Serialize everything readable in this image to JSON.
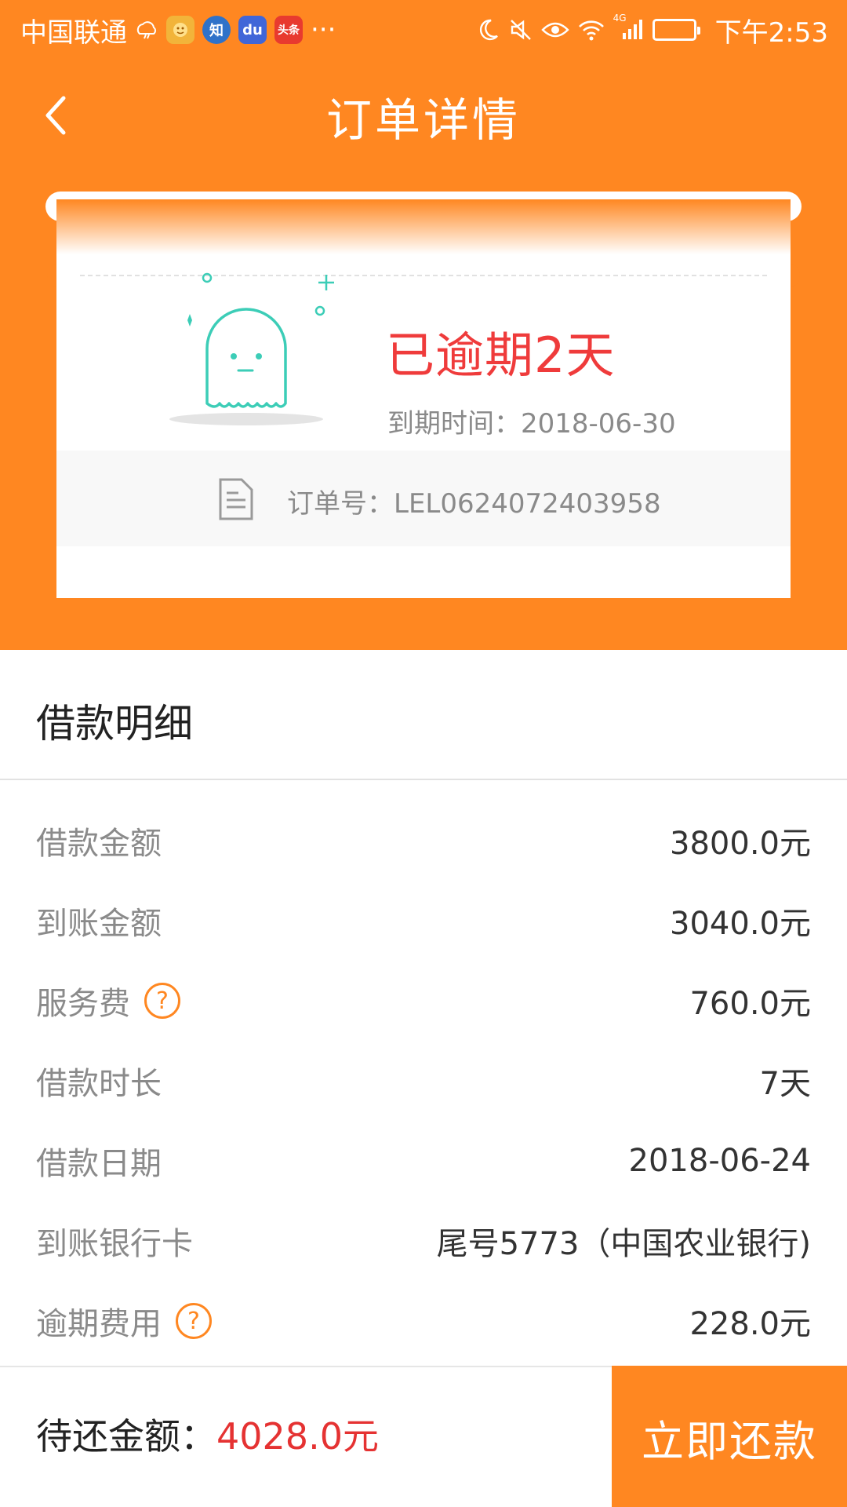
{
  "status_bar": {
    "carrier": "中国联通",
    "app_icons": [
      "weather-icon",
      "game-icon",
      "zhihu-icon",
      "baidu-icon",
      "toutiao-icon"
    ],
    "zhihu_glyph": "知",
    "baidu_glyph": "du",
    "toutiao_glyph": "头条",
    "more": "···",
    "network": "4G",
    "time": "下午2:53"
  },
  "header": {
    "title": "订单详情"
  },
  "order_card": {
    "status": "已逾期2天",
    "due_label": "到期时间：",
    "due_date": "2018-06-30",
    "order_label": "订单号：",
    "order_number": "LEL0624072403958"
  },
  "details": {
    "title": "借款明细",
    "rows": [
      {
        "label": "借款金额",
        "value": "3800.0元",
        "help": false
      },
      {
        "label": "到账金额",
        "value": "3040.0元",
        "help": false
      },
      {
        "label": "服务费",
        "value": "760.0元",
        "help": true
      },
      {
        "label": "借款时长",
        "value": "7天",
        "help": false
      },
      {
        "label": "借款日期",
        "value": "2018-06-24",
        "help": false
      },
      {
        "label": "到账银行卡",
        "value": "尾号5773（中国农业银行)",
        "help": false
      },
      {
        "label": "逾期费用",
        "value": "228.0元",
        "help": true
      }
    ],
    "help_glyph": "?"
  },
  "bottom_bar": {
    "due_label": "待还金额：",
    "due_value": "4028.0元",
    "pay_button": "立即还款"
  },
  "colors": {
    "brand_orange": "#ff8721",
    "alert_red": "#ef3b3b",
    "amount_red": "#e53232",
    "ghost_teal": "#3ccdb7"
  }
}
